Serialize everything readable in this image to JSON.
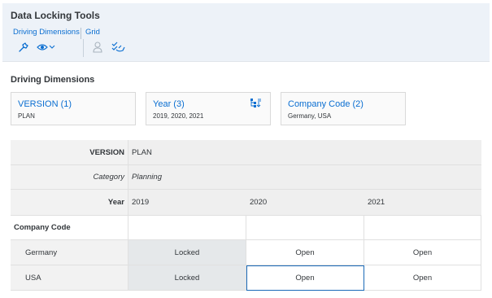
{
  "app": {
    "title": "Data Locking Tools"
  },
  "tabs": [
    {
      "label": "Driving Dimensions"
    },
    {
      "label": "Grid"
    }
  ],
  "toolbar": {
    "icons": [
      "wrench-icon",
      "eye-dropdown-icon",
      "person-icon",
      "check-list-icon"
    ]
  },
  "section": {
    "title": "Driving Dimensions"
  },
  "cards": [
    {
      "title": "VERSION (1)",
      "subtitle": "PLAN"
    },
    {
      "title": "Year (3)",
      "subtitle": "2019, 2020, 2021",
      "icon": "hierarchy-sort-icon"
    },
    {
      "title": "Company Code (2)",
      "subtitle": "Germany, USA"
    }
  ],
  "grid": {
    "version_label": "VERSION",
    "version_value": "PLAN",
    "category_label": "Category",
    "category_value": "Planning",
    "year_label": "Year",
    "years": [
      "2019",
      "2020",
      "2021"
    ],
    "row_header": "Company Code",
    "rows": [
      {
        "label": "Germany",
        "cells": [
          "Locked",
          "Open",
          "Open"
        ]
      },
      {
        "label": "USA",
        "cells": [
          "Locked",
          "Open",
          "Open"
        ]
      }
    ]
  },
  "colors": {
    "accent": "#0a6ed1",
    "header_bg": "#edf2f8",
    "locked_bg": "#e5e8ea"
  }
}
